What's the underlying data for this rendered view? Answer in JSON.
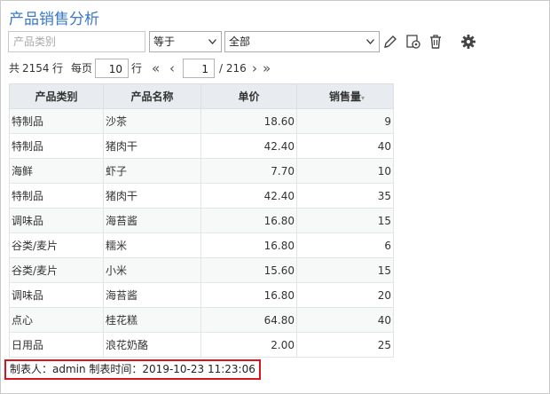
{
  "title": "产品销售分析",
  "filter": {
    "field_placeholder": "产品类别",
    "operator": "等于",
    "value": "全部"
  },
  "toolbar": {
    "icons": [
      "edit-icon",
      "copy-settings-icon",
      "trash-icon",
      "gear-icon"
    ]
  },
  "pager": {
    "total_prefix": "共",
    "total": "2154",
    "total_suffix": "行",
    "per_page_prefix": "每页",
    "per_page": "10",
    "per_page_suffix": "行",
    "first": "«",
    "prev": "‹",
    "page": "1",
    "page_total": "/ 216",
    "next": "›",
    "last": "»"
  },
  "table": {
    "headers": [
      "产品类别",
      "产品名称",
      "单价",
      "销售量"
    ],
    "rows": [
      [
        "特制品",
        "沙茶",
        "18.60",
        "9"
      ],
      [
        "特制品",
        "猪肉干",
        "42.40",
        "40"
      ],
      [
        "海鲜",
        "虾子",
        "7.70",
        "10"
      ],
      [
        "特制品",
        "猪肉干",
        "42.40",
        "35"
      ],
      [
        "调味品",
        "海苔酱",
        "16.80",
        "15"
      ],
      [
        "谷类/麦片",
        "糯米",
        "16.80",
        "6"
      ],
      [
        "谷类/麦片",
        "小米",
        "15.60",
        "15"
      ],
      [
        "调味品",
        "海苔酱",
        "16.80",
        "20"
      ],
      [
        "点心",
        "桂花糕",
        "64.80",
        "40"
      ],
      [
        "日用品",
        "浪花奶酪",
        "2.00",
        "25"
      ]
    ]
  },
  "footer": "制表人：admin 制表时间：2019-10-23 11:23:06",
  "colors": {
    "title": "#3a78c9",
    "header_bg": "#e8ecf0",
    "highlight_border": "#d8141c"
  }
}
